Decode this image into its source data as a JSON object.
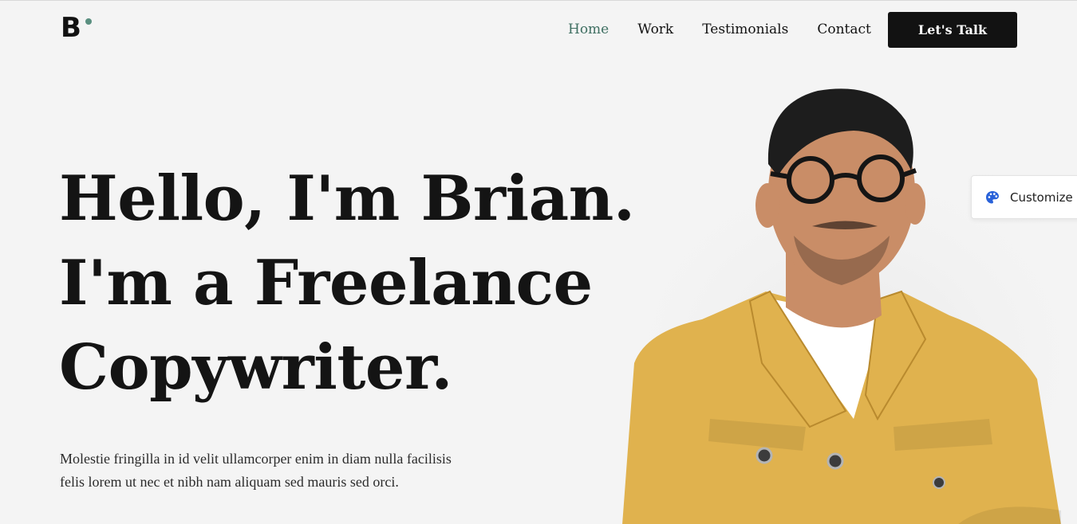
{
  "logo": {
    "letter": "B",
    "dot_color": "#5a8f80"
  },
  "nav": {
    "items": [
      {
        "label": "Home",
        "active": true
      },
      {
        "label": "Work",
        "active": false
      },
      {
        "label": "Testimonials",
        "active": false
      },
      {
        "label": "Contact",
        "active": false
      }
    ],
    "cta_label": "Let's Talk",
    "cta_color": "#121212",
    "active_color": "#3f6f62"
  },
  "hero": {
    "title_lines": [
      "Hello, I'm Brian.",
      "I'm a Freelance",
      "Copywriter."
    ],
    "subtitle_line1": "Molestie fringilla in id velit ullamcorper enim in diam nulla facilisis",
    "subtitle_line2": "felis lorem ut nec et nibh nam aliquam sed mauris sed orci."
  },
  "customize": {
    "label": "Customize",
    "icon": "palette-icon",
    "icon_color": "#2962d9"
  },
  "colors": {
    "background": "#f4f4f4",
    "jacket": "#e0b24e",
    "shirt": "#ffffff",
    "skin": "#c98d67",
    "hair": "#1d1d1d"
  }
}
